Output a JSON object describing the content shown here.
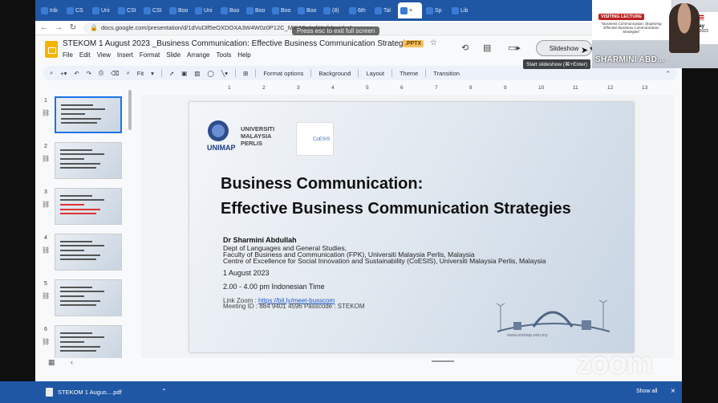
{
  "browser": {
    "tabs": [
      {
        "label": "Inb"
      },
      {
        "label": "CS"
      },
      {
        "label": "Uni"
      },
      {
        "label": "CSI"
      },
      {
        "label": "CSI"
      },
      {
        "label": "Boo"
      },
      {
        "label": "Uni"
      },
      {
        "label": "Boo"
      },
      {
        "label": "Boo"
      },
      {
        "label": "Boo"
      },
      {
        "label": "Boo"
      },
      {
        "label": "(8)"
      },
      {
        "label": "6th"
      },
      {
        "label": "Tal"
      },
      {
        "label": "×"
      },
      {
        "label": "Sp"
      },
      {
        "label": "Lib"
      }
    ],
    "url": "docs.google.com/presentation/d/1dVuDlf5eOXDOXA3W4W0z0P12C_MXjA9o/edit#slide=id.p1",
    "esc_notice": "Press  esc  to exit full screen"
  },
  "docs": {
    "title": "STEKOM 1 August 2023 _Business Communication: Effective Business Communication Strategies",
    "badge": ".PPTX",
    "menu": [
      "File",
      "Edit",
      "View",
      "Insert",
      "Format",
      "Slide",
      "Arrange",
      "Tools",
      "Help"
    ],
    "slideshow_label": "Slideshow",
    "tooltip": "Start slideshow (⌘+Enter)",
    "toolbar": {
      "zoom": "Fit",
      "format_options": "Format options",
      "background": "Background",
      "layout": "Layout",
      "theme": "Theme",
      "transition": "Transition"
    },
    "ruler": [
      "1",
      "2",
      "3",
      "4",
      "5",
      "6",
      "7",
      "8",
      "9",
      "10",
      "11",
      "12",
      "13"
    ],
    "thumbnails": [
      {
        "num": "1",
        "selected": true
      },
      {
        "num": "2",
        "selected": false
      },
      {
        "num": "3",
        "selected": false
      },
      {
        "num": "4",
        "selected": false
      },
      {
        "num": "5",
        "selected": false
      },
      {
        "num": "6",
        "selected": false
      }
    ]
  },
  "slide": {
    "university": "UNIVERSITI\nMALAYSIA\nPERLIS",
    "coesis": "CoESIS",
    "title_line1": "Business Communication:",
    "title_line2": "Effective Business Communication Strategies",
    "author": "Dr Sharmini Abdullah",
    "affiliation1": "Dept of Languages and General Studies,",
    "affiliation2": "Faculty of Business and Communication (FPK), Universiti Malaysia Perlis, Malaysia",
    "affiliation3": "Centre of Excellence for Social Innovation and Sustainability (CoESIS), Universiti Malaysia Perlis, Malaysia",
    "date": "1 August 2023",
    "time": "2.00 - 4.00 pm Indonesian Time",
    "link_label": "Link Zoom : ",
    "link_url": "https://bit.ly/meet-busscom",
    "meeting": "Meeting ID : 884 9401 4596 Passcode : STEKOM",
    "website": "www.unimap.edu.my"
  },
  "download_bar": {
    "file": "STEKOM 1 Augus....pdf",
    "show_all": "Show all"
  },
  "video": {
    "banner": "VISITING LECTURE",
    "banner_sub": "\"Business Communication: (Exploring Effective Business Communication Strategies\"",
    "day": "Tuesday",
    "date": "August 1, 2023",
    "presenter_name": "SHARMINI ABD..."
  },
  "watermark": "zoom"
}
